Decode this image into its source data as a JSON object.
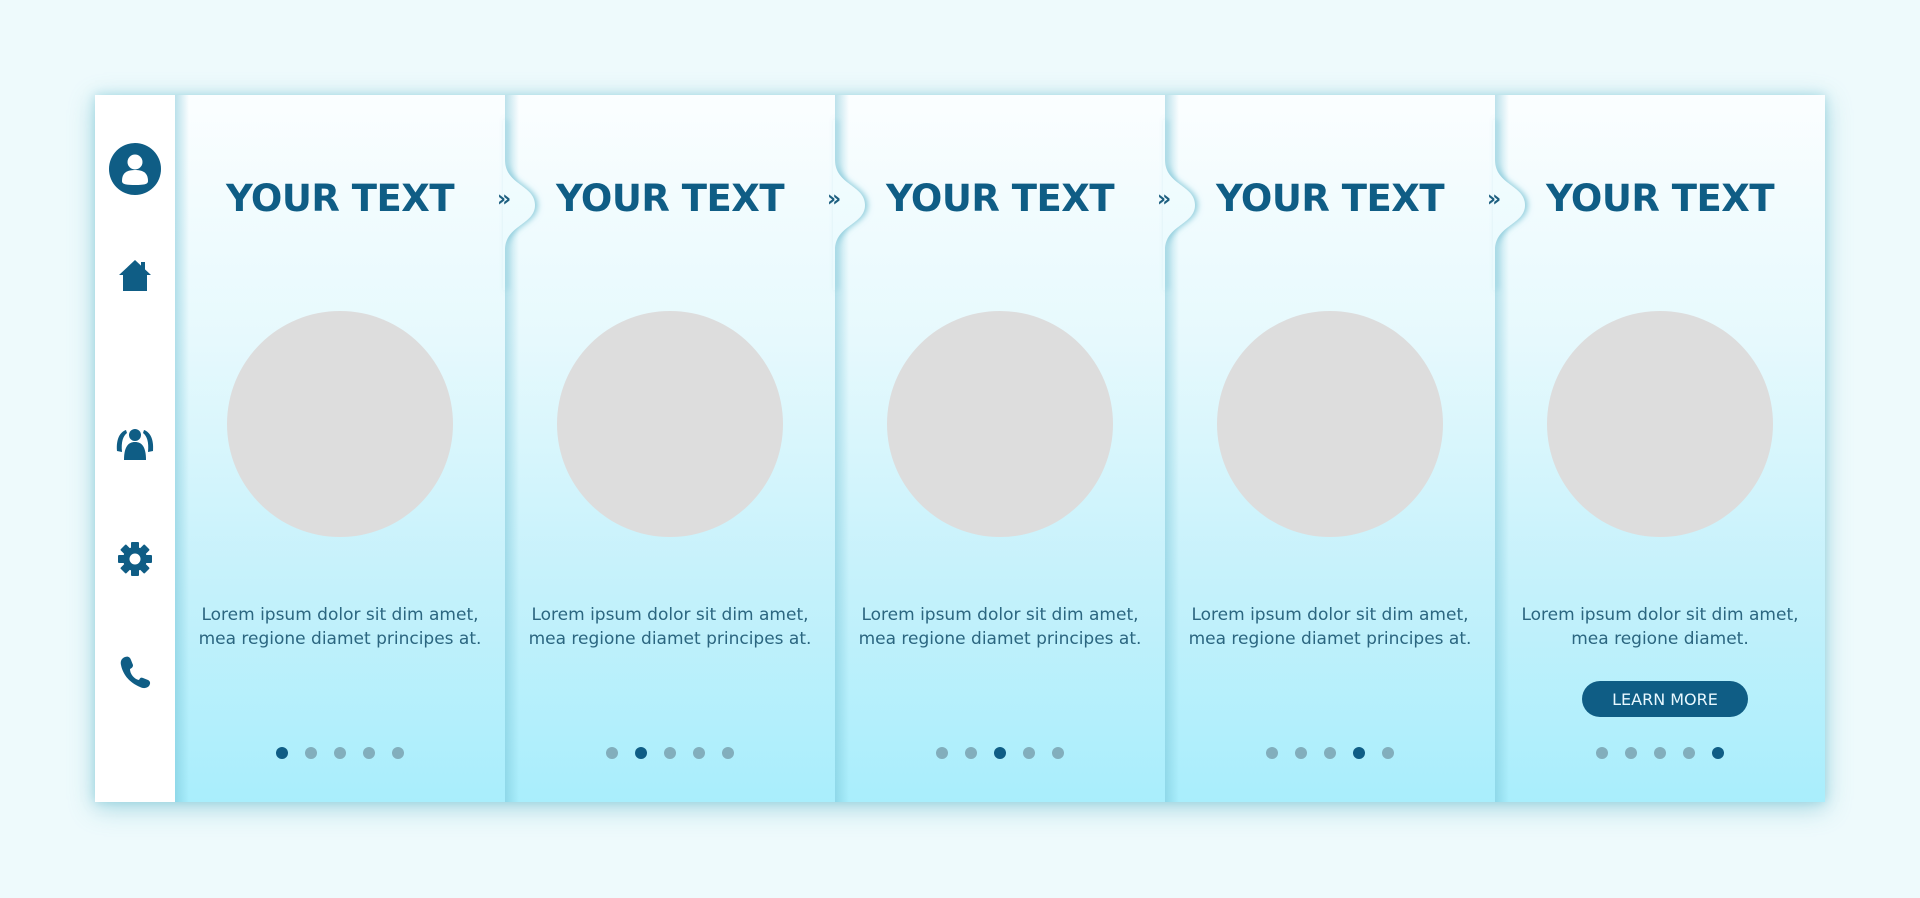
{
  "sidebar": {
    "items": [
      {
        "icon": "user-icon",
        "label": "Profile"
      },
      {
        "icon": "home-icon",
        "label": "Home"
      },
      {
        "icon": "group-icon",
        "label": "Community"
      },
      {
        "icon": "gear-icon",
        "label": "Settings"
      },
      {
        "icon": "phone-icon",
        "label": "Contact"
      }
    ]
  },
  "colors": {
    "accent": "#0f5d85",
    "dot_inactive": "#82aebc",
    "placeholder": "#dddddd",
    "gradient_top": "#fbfeff",
    "gradient_bottom": "#a9eefc"
  },
  "next_glyph": "»",
  "screens": [
    {
      "title": "YOUR TEXT",
      "body": "Lorem ipsum dolor sit dim amet, mea regione diamet principes at.",
      "active_dot": 0,
      "button": null
    },
    {
      "title": "YOUR TEXT",
      "body": "Lorem ipsum dolor sit dim amet, mea regione diamet principes at.",
      "active_dot": 1,
      "button": null
    },
    {
      "title": "YOUR TEXT",
      "body": "Lorem ipsum dolor sit dim amet, mea regione diamet principes at.",
      "active_dot": 2,
      "button": null
    },
    {
      "title": "YOUR TEXT",
      "body": "Lorem ipsum dolor sit dim amet, mea regione diamet principes at.",
      "active_dot": 3,
      "button": null
    },
    {
      "title": "YOUR TEXT",
      "body": "Lorem ipsum dolor sit dim amet, mea regione diamet.",
      "active_dot": 4,
      "button": "LEARN MORE"
    }
  ],
  "dot_count": 5
}
